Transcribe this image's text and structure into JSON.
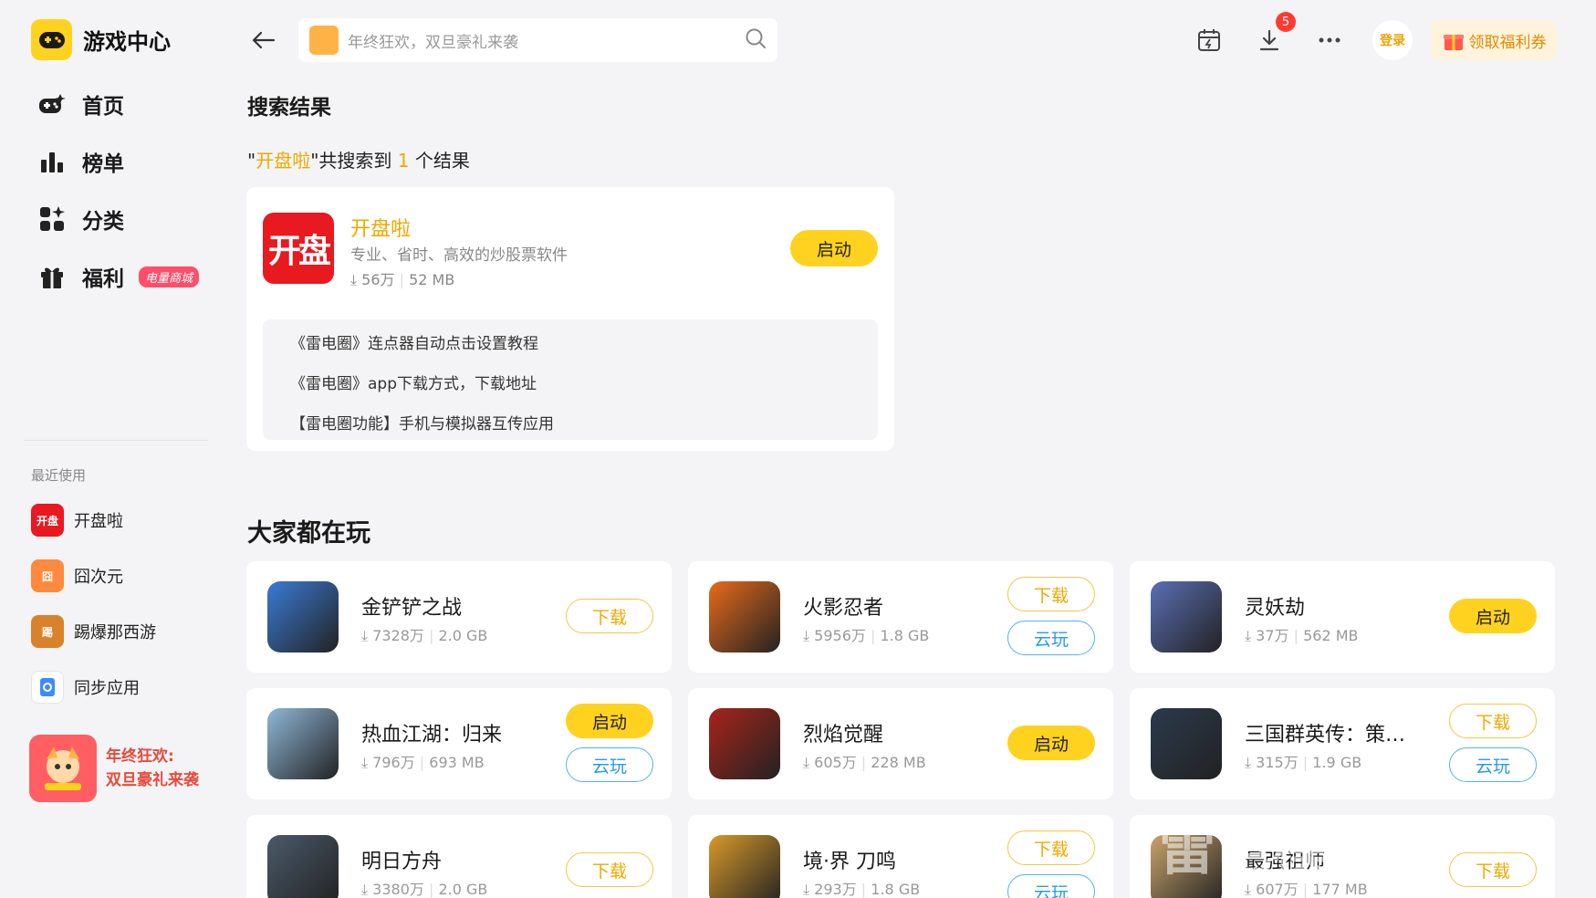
{
  "app": {
    "title": "游戏中心"
  },
  "sidebar": {
    "items": [
      {
        "label": "首页"
      },
      {
        "label": "榜单"
      },
      {
        "label": "分类"
      },
      {
        "label": "福利",
        "tag": "电量商城"
      }
    ],
    "recent_title": "最近使用",
    "recent": [
      {
        "label": "开盘啦",
        "icon_text": "开盘",
        "color": "#e8191f"
      },
      {
        "label": "囧次元",
        "icon_text": "囧",
        "color": "#ff8a3d"
      },
      {
        "label": "踢爆那西游",
        "icon_text": "踢",
        "color": "#d9822b"
      },
      {
        "label": "同步应用",
        "icon_text": "",
        "color": "#ffffff"
      }
    ],
    "promo": {
      "line1": "年终狂欢:",
      "line2": "双旦豪礼来袭"
    }
  },
  "topbar": {
    "search_placeholder": "年终狂欢，双旦豪礼来袭",
    "download_badge": "5",
    "login": "登录",
    "coupon": "领取福利券"
  },
  "search_results": {
    "title": "搜索结果",
    "query": "开盘啦",
    "count": "1",
    "prefix": "\"",
    "mid": "\"共搜索到 ",
    "suffix": " 个结果",
    "result": {
      "icon_text": "开盘",
      "name": "开盘啦",
      "desc": "专业、省时、高效的炒股票软件",
      "downloads": "56万",
      "size": "52 MB",
      "action": "启动",
      "articles": [
        "《雷电圈》连点器自动点击设置教程",
        "《雷电圈》app下载方式，下载地址",
        "【雷电圈功能】手机与模拟器互传应用"
      ]
    }
  },
  "popular": {
    "title": "大家都在玩",
    "games": [
      {
        "name": "金铲铲之战",
        "downloads": "7328万",
        "size": "2.0 GB",
        "primary": "下载",
        "secondary": "",
        "color": "#3a7bd5"
      },
      {
        "name": "火影忍者",
        "downloads": "5956万",
        "size": "1.8 GB",
        "primary": "下载",
        "secondary": "云玩",
        "color": "#e86a1a"
      },
      {
        "name": "灵妖劫",
        "downloads": "37万",
        "size": "562 MB",
        "primary": "启动",
        "secondary": "",
        "color": "#5a6fb5"
      },
      {
        "name": "热血江湖：归来",
        "downloads": "796万",
        "size": "693 MB",
        "primary": "启动",
        "secondary": "云玩",
        "color": "#8fb8d8"
      },
      {
        "name": "烈焰觉醒",
        "downloads": "605万",
        "size": "228 MB",
        "primary": "启动",
        "secondary": "",
        "color": "#a8241a"
      },
      {
        "name": "三国群英传：策定九州",
        "downloads": "315万",
        "size": "1.9 GB",
        "primary": "下载",
        "secondary": "云玩",
        "color": "#2b3a4d"
      },
      {
        "name": "明日方舟",
        "downloads": "3380万",
        "size": "2.0 GB",
        "primary": "下载",
        "secondary": "",
        "color": "#4a5a6a"
      },
      {
        "name": "境·界 刀鸣",
        "downloads": "293万",
        "size": "1.8 GB",
        "primary": "下载",
        "secondary": "云玩",
        "color": "#d89a2a"
      },
      {
        "name": "最强祖师",
        "downloads": "607万",
        "size": "177 MB",
        "primary": "下载",
        "secondary": "",
        "color": "#c9a46a"
      }
    ]
  },
  "colors": {
    "accent": "#ffd21f",
    "highlight": "#f0a800",
    "cloud": "#2a9be8"
  },
  "watermark": "雷电模拟器"
}
